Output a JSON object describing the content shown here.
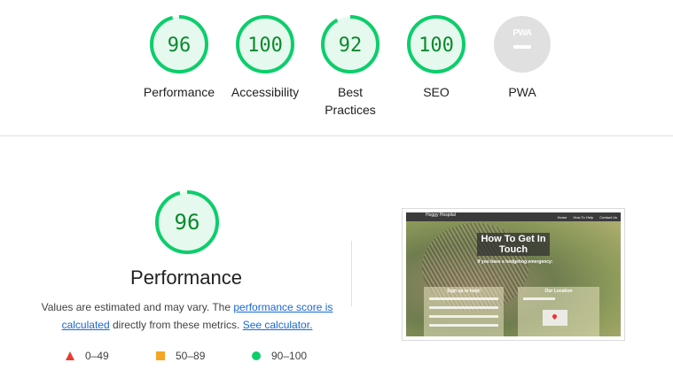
{
  "categories": [
    {
      "label": "Performance",
      "score": "96",
      "fraction": 0.96
    },
    {
      "label": "Accessibility",
      "score": "100",
      "fraction": 1.0
    },
    {
      "label": "Best Practices",
      "score": "92",
      "fraction": 0.92
    },
    {
      "label": "SEO",
      "score": "100",
      "fraction": 1.0
    },
    {
      "label": "PWA",
      "badge_text": "PWA"
    }
  ],
  "performance": {
    "score": "96",
    "fraction": 0.96,
    "title": "Performance",
    "desc_prefix": "Values are estimated and may vary. The ",
    "desc_link1": "performance score is calculated",
    "desc_middle": " directly from these metrics. ",
    "desc_link2": "See calculator."
  },
  "legend": {
    "fail": "0–49",
    "average": "50–89",
    "pass": "90–100"
  },
  "screenshot": {
    "heading": "How To Get In Touch",
    "subheading": "If you have a hedgehog emergency:",
    "form_title": "Sign up to help!",
    "location_title": "Our Location",
    "nav_logo": "Hoggy Hospital",
    "nav_links": [
      "Home",
      "How To Help",
      "Contact Us"
    ]
  },
  "colors": {
    "pass": "#0cce6b",
    "pass_text": "#0a8a2e",
    "pass_fill": "#e6f9ee",
    "average": "#f5a623",
    "fail": "#eb3b2f",
    "link": "#1967d2",
    "pwa_grey": "#e0e0e0"
  },
  "icons": {
    "fail": "triangle-icon",
    "average": "square-icon",
    "pass": "circle-icon",
    "pwa": "pwa-badge-icon"
  }
}
